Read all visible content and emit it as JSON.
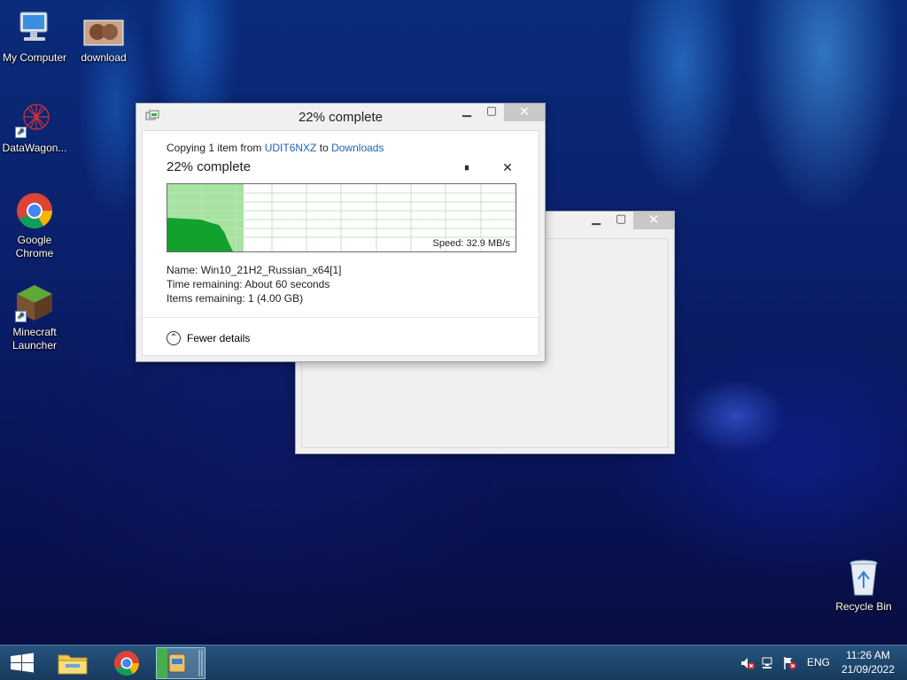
{
  "desktop": {
    "icons": [
      {
        "label": "My Computer",
        "icon": "computer-icon"
      },
      {
        "label": "download",
        "icon": "image-file-icon"
      },
      {
        "label": "DataWagon...",
        "icon": "datawagon-icon"
      },
      {
        "label": "Google Chrome",
        "icon": "chrome-icon"
      },
      {
        "label": "Minecraft Launcher",
        "icon": "minecraft-icon"
      },
      {
        "label": "Recycle Bin",
        "icon": "recycle-bin-icon"
      }
    ]
  },
  "copy_dialog": {
    "title": "22% complete",
    "copying_prefix": "Copying 1 item from",
    "source": "UDIT6NXZ",
    "to_word": "to",
    "destination": "Downloads",
    "percent_heading": "22% complete",
    "progress_fraction": 0.22,
    "speed": "Speed: 32.9 MB/s",
    "name_label": "Name:",
    "name_value": "Win10_21H2_Russian_x64[1]",
    "time_label": "Time remaining:",
    "time_value": "About 60 seconds",
    "items_label": "Items remaining:",
    "items_value": "1 (4.00 GB)",
    "fewer_details": "Fewer details",
    "accent_color": "#2eb82e"
  },
  "taskbar": {
    "language": "ENG",
    "time": "11:26 AM",
    "date": "21/09/2022"
  }
}
